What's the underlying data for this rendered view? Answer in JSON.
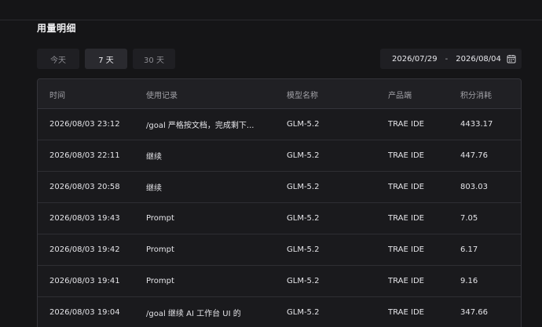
{
  "section": {
    "title": "用量明细"
  },
  "range_tabs": [
    {
      "label": "今天",
      "active": false
    },
    {
      "label": "7 天",
      "active": true
    },
    {
      "label": "30 天",
      "active": false
    }
  ],
  "date_range": {
    "start": "2026/07/29",
    "separator": "-",
    "end": "2026/08/04",
    "icon": "calendar-icon"
  },
  "table": {
    "columns": [
      "时间",
      "使用记录",
      "模型名称",
      "产品端",
      "积分消耗"
    ],
    "rows": [
      {
        "time": "2026/08/03 23:12",
        "record": "/goal 严格按文档，完成剩下...",
        "model": "GLM-5.2",
        "product": "TRAE IDE",
        "points": "4433.17"
      },
      {
        "time": "2026/08/03 22:11",
        "record": "继续",
        "model": "GLM-5.2",
        "product": "TRAE IDE",
        "points": "447.76"
      },
      {
        "time": "2026/08/03 20:58",
        "record": "继续",
        "model": "GLM-5.2",
        "product": "TRAE IDE",
        "points": "803.03"
      },
      {
        "time": "2026/08/03 19:43",
        "record": "Prompt",
        "model": "GLM-5.2",
        "product": "TRAE IDE",
        "points": "7.05"
      },
      {
        "time": "2026/08/03 19:42",
        "record": "Prompt",
        "model": "GLM-5.2",
        "product": "TRAE IDE",
        "points": "6.17"
      },
      {
        "time": "2026/08/03 19:41",
        "record": "Prompt",
        "model": "GLM-5.2",
        "product": "TRAE IDE",
        "points": "9.16"
      },
      {
        "time": "2026/08/03 19:04",
        "record": "/goal 继续 AI 工作台 UI 的",
        "model": "GLM-5.2",
        "product": "TRAE IDE",
        "points": "347.66"
      }
    ]
  }
}
